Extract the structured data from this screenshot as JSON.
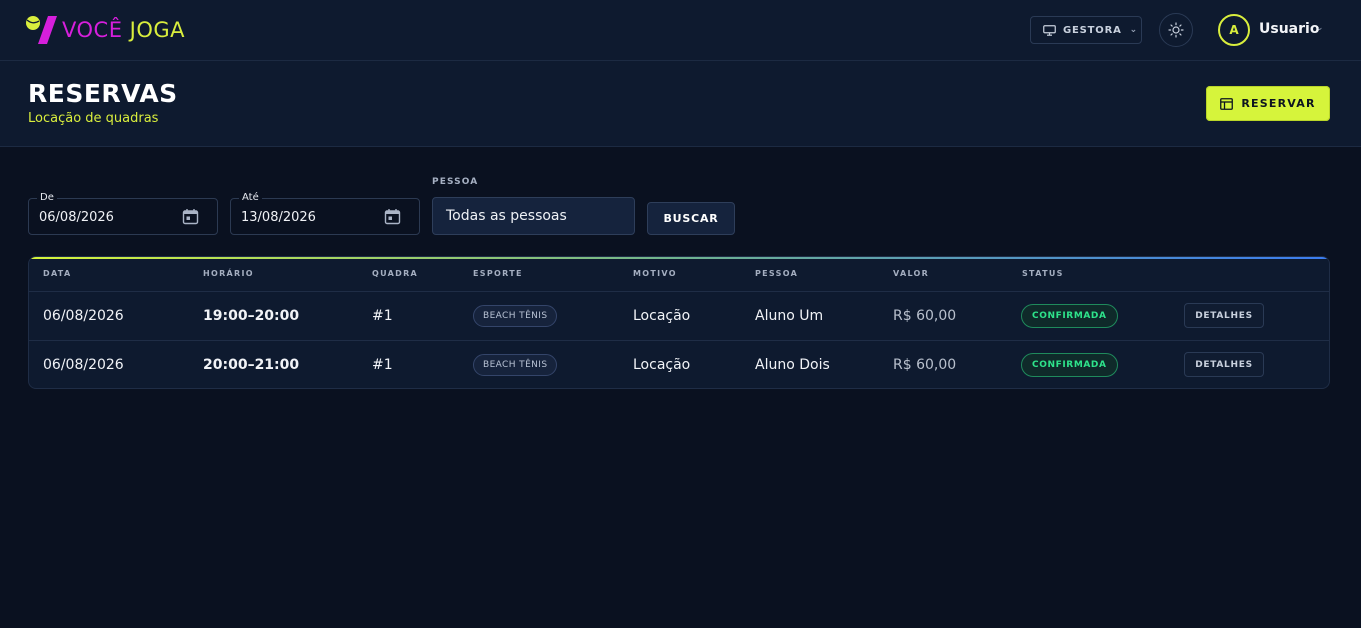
{
  "brand": {
    "word1": "VOCÊ",
    "word2": "JOGA",
    "primary_color": "#d61fdc",
    "accent_color": "#d9ee3d"
  },
  "topbar": {
    "role_label": "GESTORA",
    "role_icon": "monitor-icon",
    "theme_icon": "sun-icon",
    "user_initial": "A",
    "user_name": "Usuario"
  },
  "header": {
    "title": "RESERVAS",
    "subtitle": "Locação de quadras",
    "reserve_button": "RESERVAR"
  },
  "filters": {
    "from_label": "De",
    "from_value": "06/08/2026",
    "to_label": "Até",
    "to_value": "13/08/2026",
    "person_label": "PESSOA",
    "person_value": "Todas as pessoas",
    "search_button": "BUSCAR"
  },
  "table": {
    "columns": [
      "DATA",
      "HORÁRIO",
      "QUADRA",
      "ESPORTE",
      "MOTIVO",
      "PESSOA",
      "VALOR",
      "STATUS"
    ],
    "rows": [
      {
        "data": "06/08/2026",
        "horario": "19:00–20:00",
        "quadra": "#1",
        "esporte": "BEACH TÊNIS",
        "motivo": "Locação",
        "pessoa": "Aluno Um",
        "valor": "R$ 60,00",
        "status": "CONFIRMADA",
        "action": "DETALHES"
      },
      {
        "data": "06/08/2026",
        "horario": "20:00–21:00",
        "quadra": "#1",
        "esporte": "BEACH TÊNIS",
        "motivo": "Locação",
        "pessoa": "Aluno Dois",
        "valor": "R$ 60,00",
        "status": "CONFIRMADA",
        "action": "DETALHES"
      }
    ]
  },
  "colors": {
    "background": "#0a1120",
    "surface": "#0e1a2f",
    "cta": "#d6f43b",
    "status_confirmed": "#2ee38b"
  }
}
